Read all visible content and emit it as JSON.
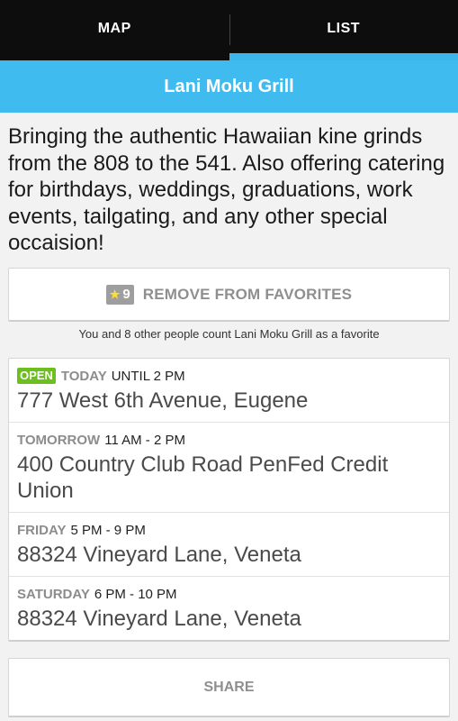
{
  "tabs": [
    {
      "label": "MAP"
    },
    {
      "label": "LIST"
    }
  ],
  "header": {
    "title": "Lani Moku Grill"
  },
  "description": "Bringing the authentic Hawaiian kine grinds from the 808 to the 541. Also offering catering for birthdays, weddings, graduations, work events, tailgating, and any other special occaision!",
  "favorites": {
    "count": "9",
    "star_icon": "star-icon",
    "button_label": "REMOVE FROM FAVORITES",
    "note": "You and 8 other people count Lani Moku Grill as a favorite"
  },
  "schedule": [
    {
      "badge": "OPEN",
      "day": "TODAY",
      "hours": "UNTIL 2 PM",
      "address": "777 West 6th Avenue, Eugene"
    },
    {
      "badge": "",
      "day": "TOMORROW",
      "hours": "11 AM - 2 PM",
      "address": "400 Country Club Road PenFed Credit Union"
    },
    {
      "badge": "",
      "day": "FRIDAY",
      "hours": "5 PM - 9 PM",
      "address": "88324 Vineyard Lane, Veneta"
    },
    {
      "badge": "",
      "day": "SATURDAY",
      "hours": "6 PM - 10 PM",
      "address": "88324 Vineyard Lane, Veneta"
    }
  ],
  "share": {
    "label": "SHARE"
  },
  "colors": {
    "tab_bar": "#0d0d0d",
    "accent": "#3fbbf0",
    "open_badge": "#6cbf1e"
  }
}
